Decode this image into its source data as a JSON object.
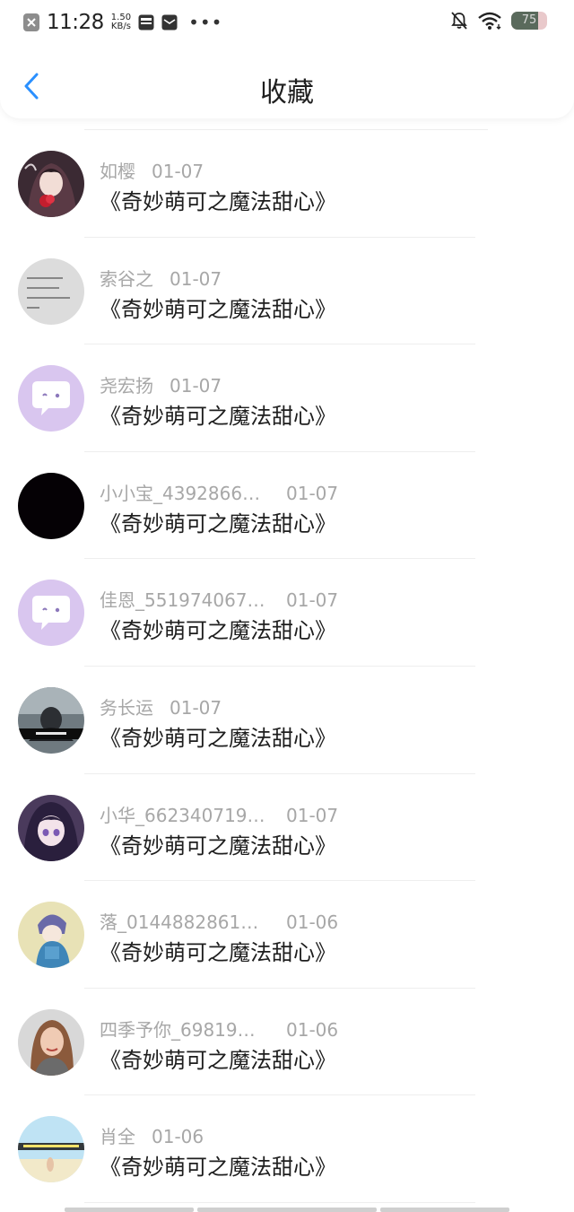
{
  "status_bar": {
    "time": "11:28",
    "speed_value": "1.50",
    "speed_unit": "KB/s",
    "more_dots": "•••",
    "battery_level": "75"
  },
  "header": {
    "title": "收藏",
    "back_icon": "chevron-left-icon"
  },
  "colors": {
    "accent": "#2a90ff",
    "meta_text": "#a7a7a7",
    "body_text": "#1e1e1e"
  },
  "favorites": [
    {
      "name": "如樱",
      "date": "01-07",
      "content": "《奇妙萌可之魔法甜心》",
      "avatar": "anime-girl-rose"
    },
    {
      "name": "索谷之",
      "date": "01-07",
      "content": "《奇妙萌可之魔法甜心》",
      "avatar": "text-calligraphy"
    },
    {
      "name": "尧宏扬",
      "date": "01-07",
      "content": "《奇妙萌可之魔法甜心》",
      "avatar": "default-chat-bubble"
    },
    {
      "name": "小小宝_4392866…",
      "date": "01-07",
      "content": "《奇妙萌可之魔法甜心》",
      "avatar": "black"
    },
    {
      "name": "佳恩_551974067…",
      "date": "01-07",
      "content": "《奇妙萌可之魔法甜心》",
      "avatar": "default-chat-bubble"
    },
    {
      "name": "务长运",
      "date": "01-07",
      "content": "《奇妙萌可之魔法甜心》",
      "avatar": "dark-photo"
    },
    {
      "name": "小华_662340719…",
      "date": "01-07",
      "content": "《奇妙萌可之魔法甜心》",
      "avatar": "anime-girl-purple"
    },
    {
      "name": "落_0144882861…",
      "date": "01-06",
      "content": "《奇妙萌可之魔法甜心》",
      "avatar": "anime-boy-blue"
    },
    {
      "name": "四季予你_69819…",
      "date": "01-06",
      "content": "《奇妙萌可之魔法甜心》",
      "avatar": "portrait-woman"
    },
    {
      "name": "肖全",
      "date": "01-06",
      "content": "《奇妙萌可之魔法甜心》",
      "avatar": "beach-photo"
    }
  ]
}
